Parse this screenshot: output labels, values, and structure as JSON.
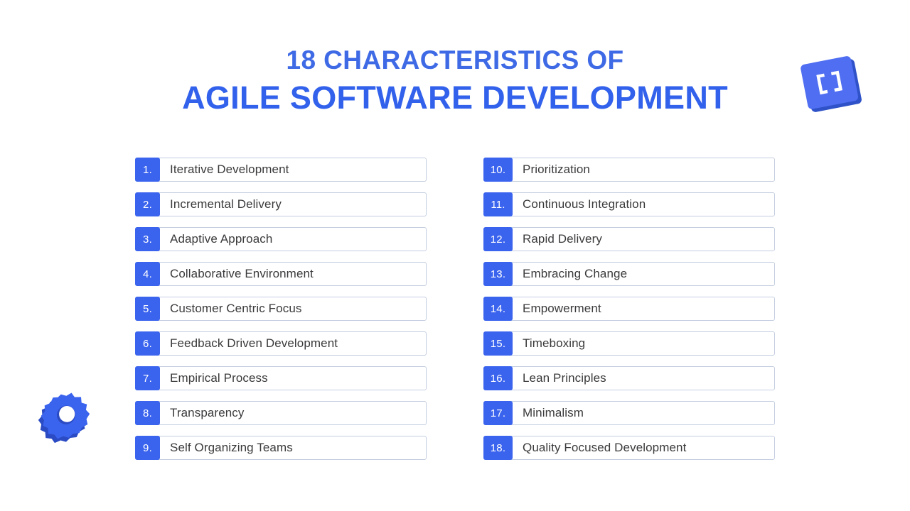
{
  "title": {
    "line_1": "18 CHARACTERISTICS OF",
    "line_2": "AGILE SOFTWARE DEVELOPMENT"
  },
  "colors": {
    "background": "#ffffff",
    "title_primary": "#3f6ae6",
    "title_secondary": "#3261ec",
    "badge_blue": "#3a63ee",
    "badge_text": "#ffffff",
    "row_border": "#c3cde0",
    "row_background": "#ffffff",
    "label_text": "#3a3a3c",
    "icon_blue": "#4f6ef2",
    "icon_blue_dark": "#2f52c9",
    "gear_blue": "#3a63ee",
    "gear_blue_dark": "#2b4bc4"
  },
  "decorations": [
    {
      "name": "code-bracket-icon",
      "glyph": "[ ]",
      "position": "top-right"
    },
    {
      "name": "gear-icon",
      "glyph": "gear",
      "position": "bottom-left"
    }
  ],
  "columns": {
    "left": [
      {
        "number": "1.",
        "label": "Iterative Development"
      },
      {
        "number": "2.",
        "label": "Incremental Delivery"
      },
      {
        "number": "3.",
        "label": "Adaptive Approach"
      },
      {
        "number": "4.",
        "label": "Collaborative Environment"
      },
      {
        "number": "5.",
        "label": "Customer Centric Focus"
      },
      {
        "number": "6.",
        "label": "Feedback Driven Development"
      },
      {
        "number": "7.",
        "label": "Empirical Process"
      },
      {
        "number": "8.",
        "label": "Transparency"
      },
      {
        "number": "9.",
        "label": "Self Organizing Teams"
      }
    ],
    "right": [
      {
        "number": "10.",
        "label": "Prioritization"
      },
      {
        "number": "11.",
        "label": "Continuous Integration"
      },
      {
        "number": "12.",
        "label": "Rapid Delivery"
      },
      {
        "number": "13.",
        "label": "Embracing Change"
      },
      {
        "number": "14.",
        "label": "Empowerment"
      },
      {
        "number": "15.",
        "label": "Timeboxing"
      },
      {
        "number": "16.",
        "label": "Lean Principles"
      },
      {
        "number": "17.",
        "label": "Minimalism"
      },
      {
        "number": "18.",
        "label": "Quality Focused Development"
      }
    ]
  }
}
